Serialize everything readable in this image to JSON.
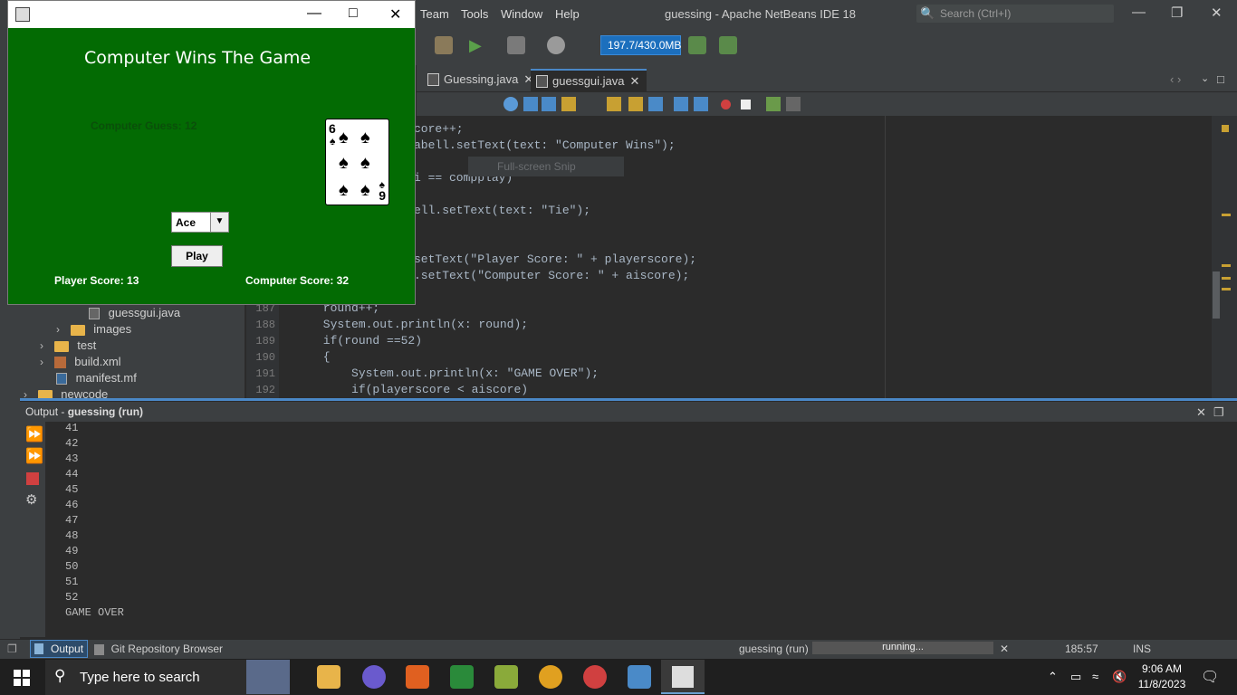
{
  "ide": {
    "menu": [
      "Team",
      "Tools",
      "Window",
      "Help"
    ],
    "title": "guessing - Apache NetBeans IDE 18",
    "search_placeholder": "Search (Ctrl+I)",
    "memory": "197.7/430.0MB",
    "tabs": [
      {
        "label": "Guessing.java",
        "active": false
      },
      {
        "label": "guessgui.java",
        "active": true
      }
    ],
    "overlay_text": "Full-screen Snip"
  },
  "code": {
    "lines": [
      {
        "num": "",
        "text": "core++;"
      },
      {
        "num": "",
        "text": "abell.setText(text: \"Computer Wins\");"
      },
      {
        "num": "",
        "text": ""
      },
      {
        "num": "",
        "text": "i == compplay)"
      },
      {
        "num": "",
        "text": ""
      },
      {
        "num": "",
        "text": "ell.setText(text: \"Tie\");"
      },
      {
        "num": "",
        "text": ""
      },
      {
        "num": "",
        "text": ""
      },
      {
        "num": "",
        "text": "setText(\"Player Score: \" + playerscore);"
      },
      {
        "num": "",
        "text": ".setText(\"Computer Score: \" + aiscore);"
      },
      {
        "num": "",
        "text": ""
      },
      {
        "num": "187",
        "text": "      round++;"
      },
      {
        "num": "188",
        "text": "      System.out.println(x: round);"
      },
      {
        "num": "189",
        "text": "      if(round ==52)"
      },
      {
        "num": "190",
        "text": "      {"
      },
      {
        "num": "191",
        "text": "          System.out.println(x: \"GAME OVER\");"
      },
      {
        "num": "192",
        "text": "          if(playerscore < aiscore)"
      }
    ]
  },
  "project": {
    "items": [
      {
        "label": "guessgui.java",
        "indent": 3,
        "kind": "file"
      },
      {
        "label": "images",
        "indent": 2,
        "kind": "folder"
      },
      {
        "label": "test",
        "indent": 1,
        "kind": "folder"
      },
      {
        "label": "build.xml",
        "indent": 1,
        "kind": "file"
      },
      {
        "label": "manifest.mf",
        "indent": 1,
        "kind": "file"
      },
      {
        "label": "newcode",
        "indent": 0,
        "kind": "folder"
      }
    ]
  },
  "output": {
    "title_prefix": "Output - ",
    "title_bold": "guessing (run)",
    "lines": [
      "41",
      "42",
      "43",
      "44",
      "45",
      "46",
      "47",
      "48",
      "49",
      "50",
      "51",
      "52",
      "GAME OVER"
    ]
  },
  "status": {
    "tab_output": "Output",
    "tab_git": "Git Repository Browser",
    "task": "guessing (run)",
    "progress": "running...",
    "position": "185:57",
    "mode": "INS"
  },
  "taskbar": {
    "search_placeholder": "Type here to search",
    "time": "9:06 AM",
    "date": "11/8/2023"
  },
  "game": {
    "heading": "Computer Wins The Game",
    "computer_guess": "Computer Guess: 12",
    "card_rank_top": "6",
    "card_rank_bottom": "9",
    "card_suit": "spade",
    "selected_rank": "Ace",
    "play_label": "Play",
    "player_score": "Player Score: 13",
    "computer_score": "Computer Score: 32"
  },
  "colors": {
    "game_bg": "#036b03",
    "ide_bg": "#2b2b2b",
    "accent": "#4a88c7"
  }
}
